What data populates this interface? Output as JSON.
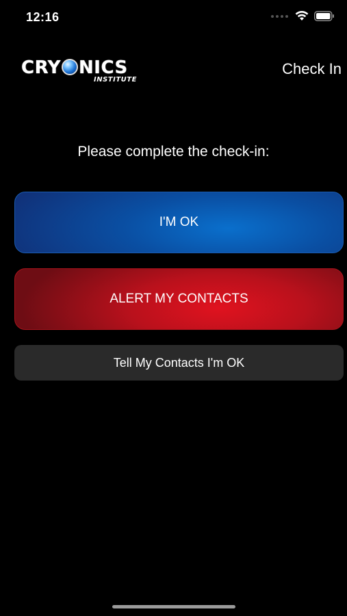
{
  "status_bar": {
    "time": "12:16"
  },
  "header": {
    "logo_main_left": "CRY",
    "logo_main_right": "NICS",
    "logo_sub": "INSTITUTE",
    "title": "Check In"
  },
  "main": {
    "prompt": "Please complete the check-in:",
    "ok_label": "I'M OK",
    "alert_label": "ALERT MY CONTACTS",
    "tell_label": "Tell My Contacts I'm OK"
  },
  "colors": {
    "ok_button": "#0a5fb8",
    "alert_button": "#d0121d",
    "tell_button": "#2a2a2a",
    "background": "#000000"
  }
}
